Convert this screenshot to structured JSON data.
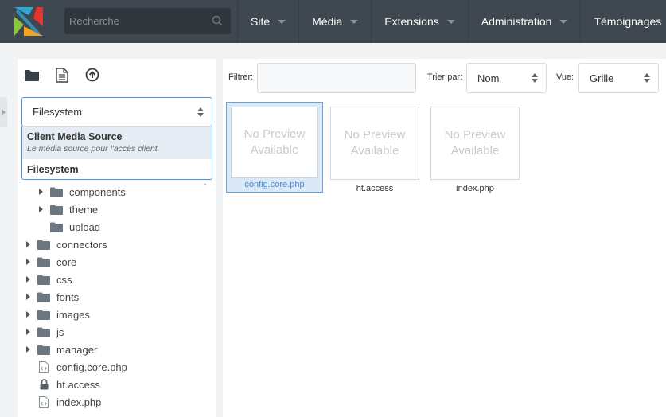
{
  "topbar": {
    "search_placeholder": "Recherche",
    "nav": [
      {
        "label": "Site",
        "has_caret": true
      },
      {
        "label": "Média",
        "has_caret": true
      },
      {
        "label": "Extensions",
        "has_caret": true
      },
      {
        "label": "Administration",
        "has_caret": true
      },
      {
        "label": "Témoignages",
        "has_caret": false
      }
    ]
  },
  "left": {
    "toolbar_icons": [
      "folder-icon",
      "new-file-icon",
      "upload-icon"
    ],
    "source_select": {
      "value": "Filesystem",
      "options": [
        {
          "title": "Client Media Source",
          "description": "Le média source pour l'accès client."
        },
        {
          "title": "Filesystem",
          "description": ""
        }
      ]
    },
    "tree": [
      {
        "label": "components",
        "type": "folder",
        "expandable": true
      },
      {
        "label": "theme",
        "type": "folder",
        "expandable": true
      },
      {
        "label": "upload",
        "type": "folder",
        "expandable": false
      },
      {
        "label": "connectors",
        "type": "folder",
        "expandable": true
      },
      {
        "label": "core",
        "type": "folder",
        "expandable": true
      },
      {
        "label": "css",
        "type": "folder",
        "expandable": true
      },
      {
        "label": "fonts",
        "type": "folder",
        "expandable": true
      },
      {
        "label": "images",
        "type": "folder",
        "expandable": true
      },
      {
        "label": "js",
        "type": "folder",
        "expandable": true
      },
      {
        "label": "manager",
        "type": "folder",
        "expandable": true
      },
      {
        "label": "config.core.php",
        "type": "code-file"
      },
      {
        "label": "ht.access",
        "type": "locked-file"
      },
      {
        "label": "index.php",
        "type": "code-file"
      }
    ]
  },
  "right": {
    "filter_label": "Filtrer:",
    "sort_label": "Trier par:",
    "sort_value": "Nom",
    "view_label": "Vue:",
    "view_value": "Grille",
    "no_preview_line1": "No Preview",
    "no_preview_line2": "Available",
    "files": [
      {
        "name": "config.core.php",
        "selected": true
      },
      {
        "name": "ht.access",
        "selected": false
      },
      {
        "name": "index.php",
        "selected": false
      }
    ]
  },
  "colors": {
    "topbar": "#3f4850",
    "accent": "#4a90d9",
    "folder": "#6b7680"
  }
}
